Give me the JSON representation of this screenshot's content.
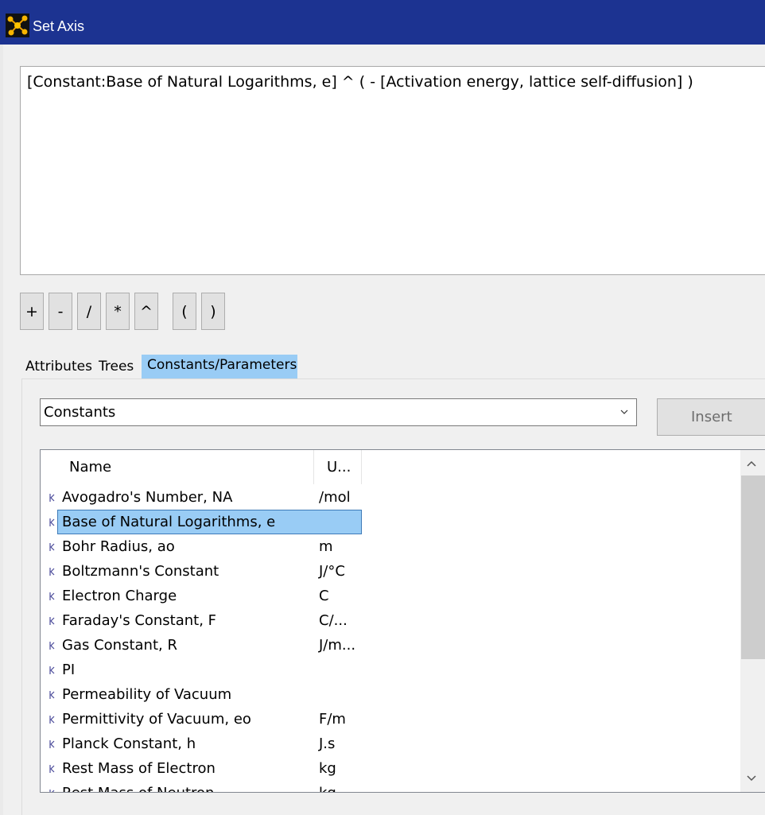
{
  "window": {
    "title": "Set Axis",
    "titlebar_color": "#1c3391"
  },
  "expression": "[Constant:Base of Natural Logarithms, e] ^  (  - [Activation energy, lattice self-diffusion] )",
  "operators": [
    "+",
    "-",
    "/",
    "*",
    "^",
    "(",
    ")"
  ],
  "tabs": [
    {
      "label": "Attributes",
      "active": false
    },
    {
      "label": "Trees",
      "active": false
    },
    {
      "label": "Constants/Parameters",
      "active": true
    }
  ],
  "selection_color": "#99ccf5",
  "dropdown": {
    "selected": "Constants",
    "icon": "chevron-down-icon"
  },
  "insert_label": "Insert",
  "list": {
    "columns": [
      "Name",
      "U..."
    ],
    "rows": [
      {
        "name": "Avogadro's Number, NA",
        "unit": "/mol",
        "selected": false
      },
      {
        "name": "Base of Natural Logarithms, e",
        "unit": "",
        "selected": true
      },
      {
        "name": "Bohr Radius, ao",
        "unit": "m",
        "selected": false
      },
      {
        "name": "Boltzmann's Constant",
        "unit": "J/°C",
        "selected": false
      },
      {
        "name": "Electron Charge",
        "unit": "C",
        "selected": false
      },
      {
        "name": "Faraday's Constant, F",
        "unit": "C/...",
        "selected": false
      },
      {
        "name": "Gas Constant, R",
        "unit": "J/m...",
        "selected": false
      },
      {
        "name": "PI",
        "unit": "",
        "selected": false
      },
      {
        "name": "Permeability of Vacuum",
        "unit": "",
        "selected": false
      },
      {
        "name": "Permittivity of Vacuum, eo",
        "unit": "F/m",
        "selected": false
      },
      {
        "name": "Planck Constant, h",
        "unit": "J.s",
        "selected": false
      },
      {
        "name": "Rest Mass of Electron",
        "unit": "kg",
        "selected": false
      },
      {
        "name": "Rest Mass of Neutron",
        "unit": "kg",
        "selected": false
      }
    ]
  }
}
